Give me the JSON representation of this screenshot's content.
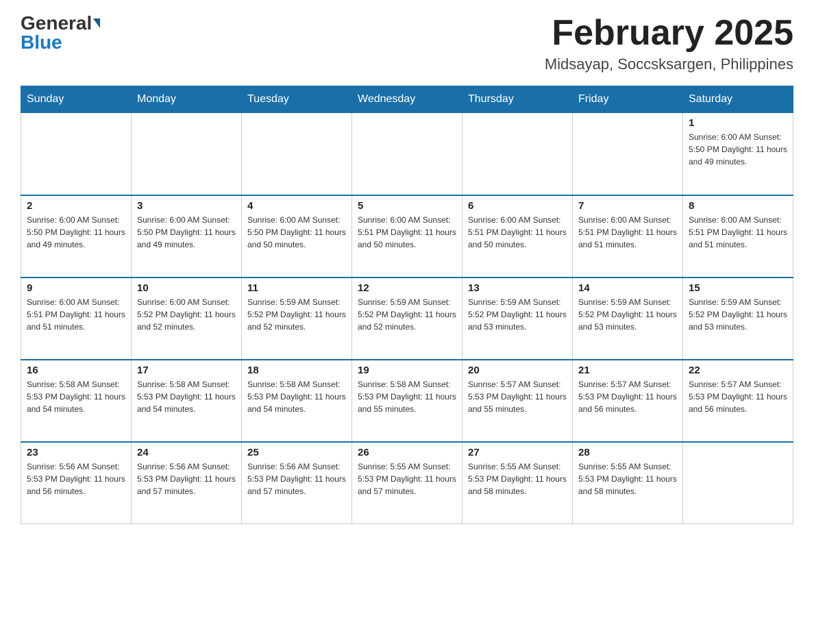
{
  "header": {
    "logo_general": "General",
    "logo_blue": "Blue",
    "month_year": "February 2025",
    "location": "Midsayap, Soccsksargen, Philippines"
  },
  "days_of_week": [
    "Sunday",
    "Monday",
    "Tuesday",
    "Wednesday",
    "Thursday",
    "Friday",
    "Saturday"
  ],
  "weeks": [
    [
      {
        "day": "",
        "info": ""
      },
      {
        "day": "",
        "info": ""
      },
      {
        "day": "",
        "info": ""
      },
      {
        "day": "",
        "info": ""
      },
      {
        "day": "",
        "info": ""
      },
      {
        "day": "",
        "info": ""
      },
      {
        "day": "1",
        "info": "Sunrise: 6:00 AM\nSunset: 5:50 PM\nDaylight: 11 hours\nand 49 minutes."
      }
    ],
    [
      {
        "day": "2",
        "info": "Sunrise: 6:00 AM\nSunset: 5:50 PM\nDaylight: 11 hours\nand 49 minutes."
      },
      {
        "day": "3",
        "info": "Sunrise: 6:00 AM\nSunset: 5:50 PM\nDaylight: 11 hours\nand 49 minutes."
      },
      {
        "day": "4",
        "info": "Sunrise: 6:00 AM\nSunset: 5:50 PM\nDaylight: 11 hours\nand 50 minutes."
      },
      {
        "day": "5",
        "info": "Sunrise: 6:00 AM\nSunset: 5:51 PM\nDaylight: 11 hours\nand 50 minutes."
      },
      {
        "day": "6",
        "info": "Sunrise: 6:00 AM\nSunset: 5:51 PM\nDaylight: 11 hours\nand 50 minutes."
      },
      {
        "day": "7",
        "info": "Sunrise: 6:00 AM\nSunset: 5:51 PM\nDaylight: 11 hours\nand 51 minutes."
      },
      {
        "day": "8",
        "info": "Sunrise: 6:00 AM\nSunset: 5:51 PM\nDaylight: 11 hours\nand 51 minutes."
      }
    ],
    [
      {
        "day": "9",
        "info": "Sunrise: 6:00 AM\nSunset: 5:51 PM\nDaylight: 11 hours\nand 51 minutes."
      },
      {
        "day": "10",
        "info": "Sunrise: 6:00 AM\nSunset: 5:52 PM\nDaylight: 11 hours\nand 52 minutes."
      },
      {
        "day": "11",
        "info": "Sunrise: 5:59 AM\nSunset: 5:52 PM\nDaylight: 11 hours\nand 52 minutes."
      },
      {
        "day": "12",
        "info": "Sunrise: 5:59 AM\nSunset: 5:52 PM\nDaylight: 11 hours\nand 52 minutes."
      },
      {
        "day": "13",
        "info": "Sunrise: 5:59 AM\nSunset: 5:52 PM\nDaylight: 11 hours\nand 53 minutes."
      },
      {
        "day": "14",
        "info": "Sunrise: 5:59 AM\nSunset: 5:52 PM\nDaylight: 11 hours\nand 53 minutes."
      },
      {
        "day": "15",
        "info": "Sunrise: 5:59 AM\nSunset: 5:52 PM\nDaylight: 11 hours\nand 53 minutes."
      }
    ],
    [
      {
        "day": "16",
        "info": "Sunrise: 5:58 AM\nSunset: 5:53 PM\nDaylight: 11 hours\nand 54 minutes."
      },
      {
        "day": "17",
        "info": "Sunrise: 5:58 AM\nSunset: 5:53 PM\nDaylight: 11 hours\nand 54 minutes."
      },
      {
        "day": "18",
        "info": "Sunrise: 5:58 AM\nSunset: 5:53 PM\nDaylight: 11 hours\nand 54 minutes."
      },
      {
        "day": "19",
        "info": "Sunrise: 5:58 AM\nSunset: 5:53 PM\nDaylight: 11 hours\nand 55 minutes."
      },
      {
        "day": "20",
        "info": "Sunrise: 5:57 AM\nSunset: 5:53 PM\nDaylight: 11 hours\nand 55 minutes."
      },
      {
        "day": "21",
        "info": "Sunrise: 5:57 AM\nSunset: 5:53 PM\nDaylight: 11 hours\nand 56 minutes."
      },
      {
        "day": "22",
        "info": "Sunrise: 5:57 AM\nSunset: 5:53 PM\nDaylight: 11 hours\nand 56 minutes."
      }
    ],
    [
      {
        "day": "23",
        "info": "Sunrise: 5:56 AM\nSunset: 5:53 PM\nDaylight: 11 hours\nand 56 minutes."
      },
      {
        "day": "24",
        "info": "Sunrise: 5:56 AM\nSunset: 5:53 PM\nDaylight: 11 hours\nand 57 minutes."
      },
      {
        "day": "25",
        "info": "Sunrise: 5:56 AM\nSunset: 5:53 PM\nDaylight: 11 hours\nand 57 minutes."
      },
      {
        "day": "26",
        "info": "Sunrise: 5:55 AM\nSunset: 5:53 PM\nDaylight: 11 hours\nand 57 minutes."
      },
      {
        "day": "27",
        "info": "Sunrise: 5:55 AM\nSunset: 5:53 PM\nDaylight: 11 hours\nand 58 minutes."
      },
      {
        "day": "28",
        "info": "Sunrise: 5:55 AM\nSunset: 5:53 PM\nDaylight: 11 hours\nand 58 minutes."
      },
      {
        "day": "",
        "info": ""
      }
    ]
  ]
}
